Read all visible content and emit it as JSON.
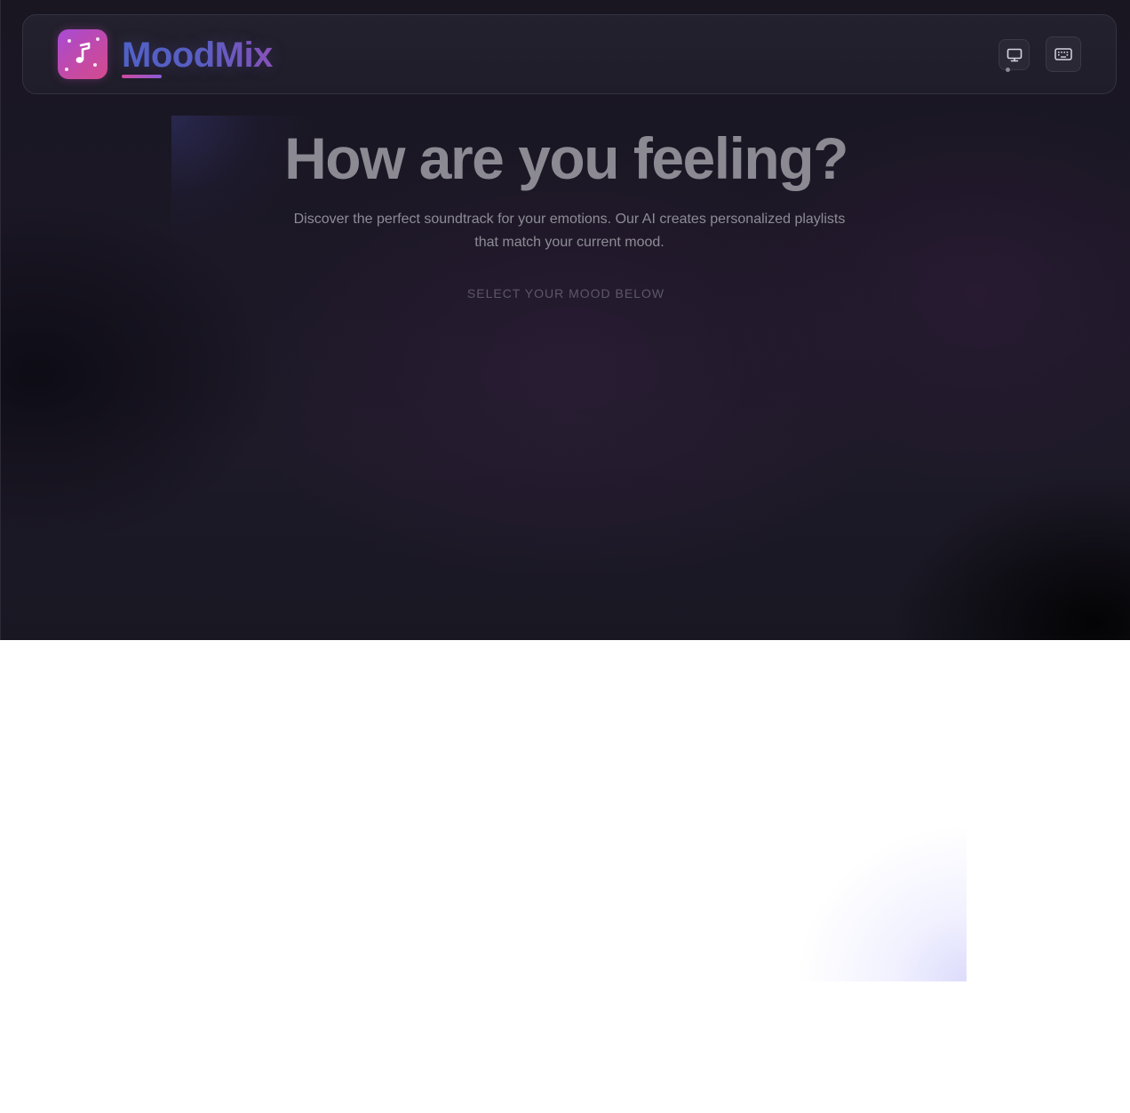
{
  "app": {
    "brand_name": "MoodMix",
    "logo_icon": "music-note-icon"
  },
  "header": {
    "actions": [
      {
        "icon": "monitor-icon"
      },
      {
        "icon": "keyboard-icon"
      }
    ]
  },
  "hero": {
    "title": "How are you feeling?",
    "subtitle_line1": "Discover the perfect soundtrack for your emotions. Our AI creates personalized playlists",
    "subtitle_line2": "that match your current mood.",
    "select_label": "SELECT YOUR MOOD BELOW"
  },
  "colors": {
    "background": "#1c1826",
    "brand_gradient_start": "#4d63c8",
    "brand_gradient_end": "#8a52b8",
    "logo_gradient_start": "#a74bd4",
    "logo_gradient_end": "#d44a8e"
  }
}
